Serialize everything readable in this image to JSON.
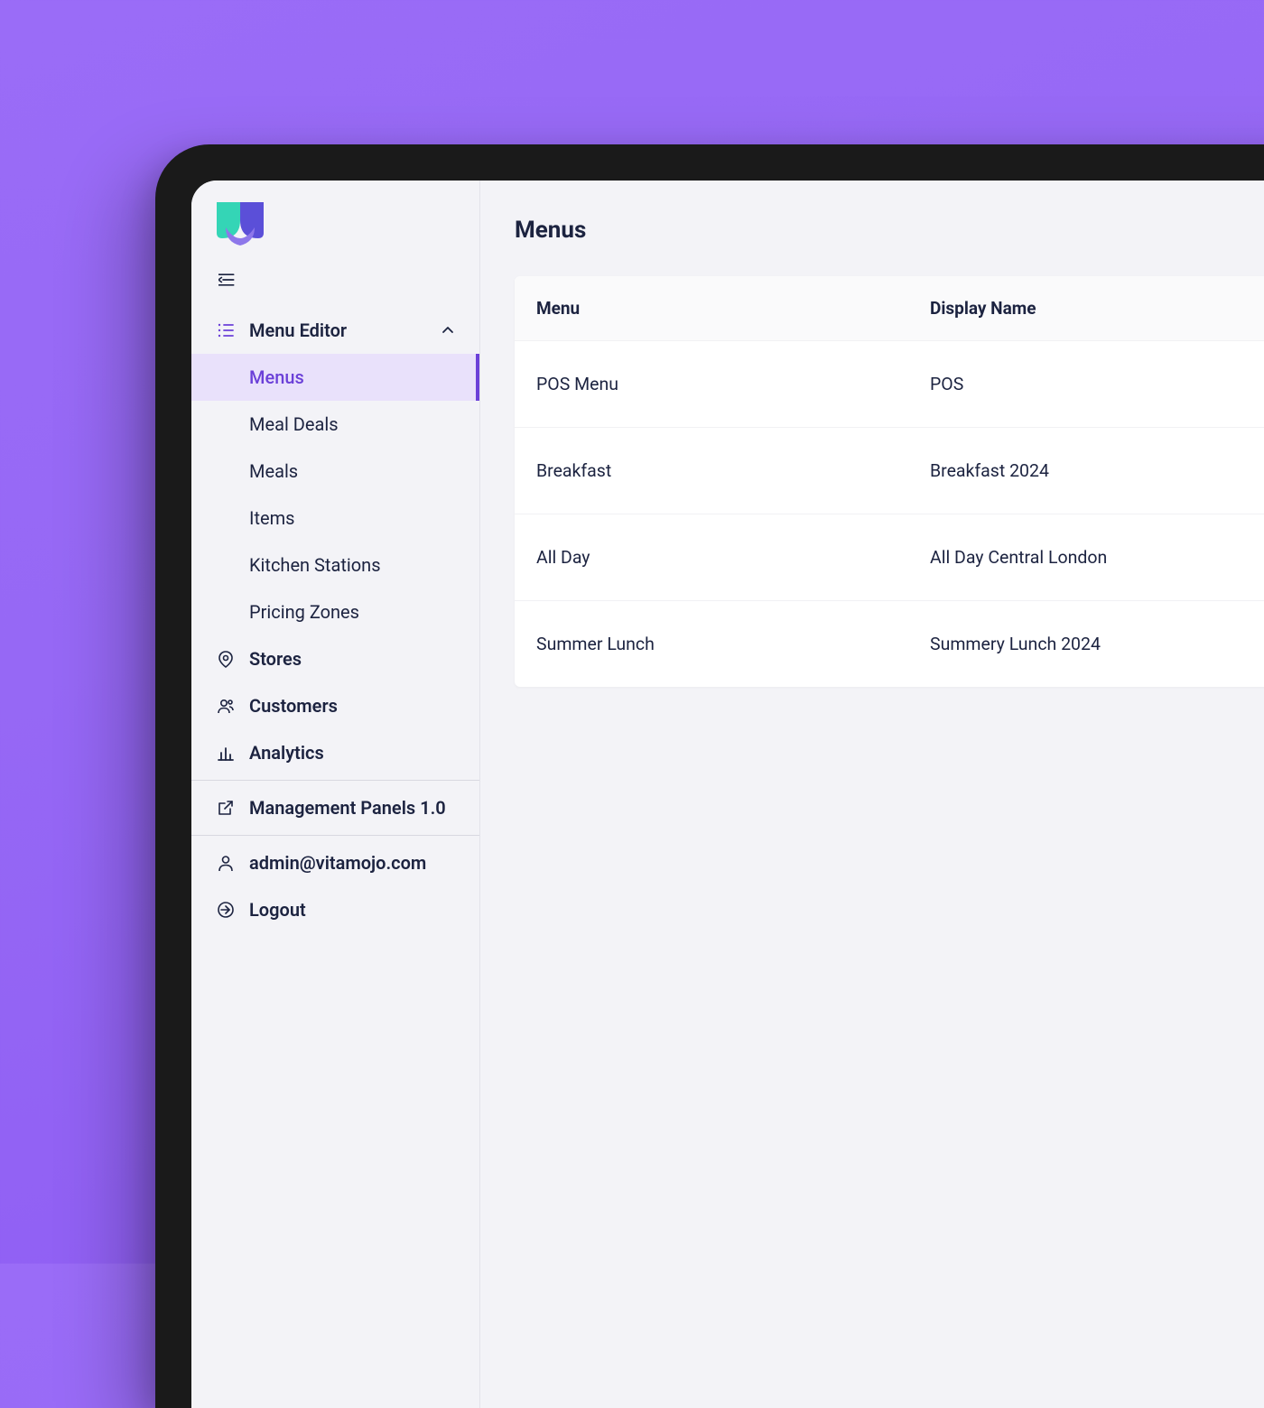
{
  "sidebar": {
    "nav": [
      {
        "label": "Menu Editor",
        "icon": "list-icon",
        "expanded": true,
        "children": [
          {
            "label": "Menus",
            "active": true
          },
          {
            "label": "Meal Deals"
          },
          {
            "label": "Meals"
          },
          {
            "label": "Items"
          },
          {
            "label": "Kitchen Stations"
          },
          {
            "label": "Pricing Zones"
          }
        ]
      },
      {
        "label": "Stores",
        "icon": "pin-icon"
      },
      {
        "label": "Customers",
        "icon": "users-icon"
      },
      {
        "label": "Analytics",
        "icon": "chart-icon"
      }
    ],
    "secondary": [
      {
        "label": "Management Panels 1.0",
        "icon": "external-icon"
      }
    ],
    "account": [
      {
        "label": "admin@vitamojo.com",
        "icon": "user-icon"
      },
      {
        "label": "Logout",
        "icon": "logout-icon"
      }
    ]
  },
  "page": {
    "title": "Menus",
    "table": {
      "headers": {
        "menu": "Menu",
        "display": "Display Name"
      },
      "rows": [
        {
          "menu": "POS Menu",
          "display": "POS"
        },
        {
          "menu": "Breakfast",
          "display": "Breakfast 2024"
        },
        {
          "menu": "All Day",
          "display": "All Day Central London"
        },
        {
          "menu": "Summer Lunch",
          "display": "Summery Lunch 2024"
        }
      ]
    }
  }
}
